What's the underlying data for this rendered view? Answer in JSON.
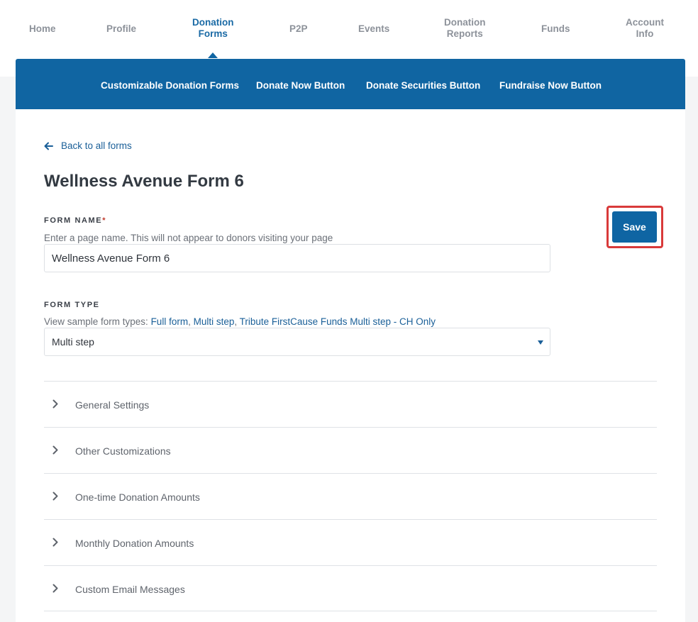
{
  "nav": {
    "items": [
      {
        "label": "Home"
      },
      {
        "label": "Profile"
      },
      {
        "label": "Donation Forms",
        "line1": "Donation",
        "line2": "Forms"
      },
      {
        "label": "P2P"
      },
      {
        "label": "Events"
      },
      {
        "label": "Donation Reports",
        "line1": "Donation",
        "line2": "Reports"
      },
      {
        "label": "Funds"
      },
      {
        "label": "Account Info",
        "line1": "Account",
        "line2": "Info"
      }
    ],
    "active": "Donation Forms"
  },
  "subnav": {
    "items": [
      {
        "label": "Customizable Donation Forms"
      },
      {
        "label": "Donate Now Button"
      },
      {
        "label": "Donate Securities Button"
      },
      {
        "label": "Fundraise Now Button"
      }
    ]
  },
  "back_link": "Back to all forms",
  "page_title": "Wellness Avenue Form 6",
  "form_name": {
    "label": "FORM NAME",
    "required_mark": "*",
    "helper": "Enter a page name. This will not appear to donors visiting your page",
    "value": "Wellness Avenue Form 6"
  },
  "form_type": {
    "label": "FORM TYPE",
    "helper_prefix": "View sample form types: ",
    "links": [
      "Full form",
      "Multi step",
      "Tribute FirstCause Funds Multi step - CH Only"
    ],
    "separator": ", ",
    "selected": "Multi step"
  },
  "save_label": "Save",
  "sections": [
    {
      "label": "General Settings"
    },
    {
      "label": "Other Customizations"
    },
    {
      "label": "One-time Donation Amounts"
    },
    {
      "label": "Monthly Donation Amounts"
    },
    {
      "label": "Custom Email Messages"
    }
  ],
  "colors": {
    "brand_blue": "#1065a2",
    "link_blue": "#1a5f98",
    "highlight_red": "#d93a3a"
  }
}
